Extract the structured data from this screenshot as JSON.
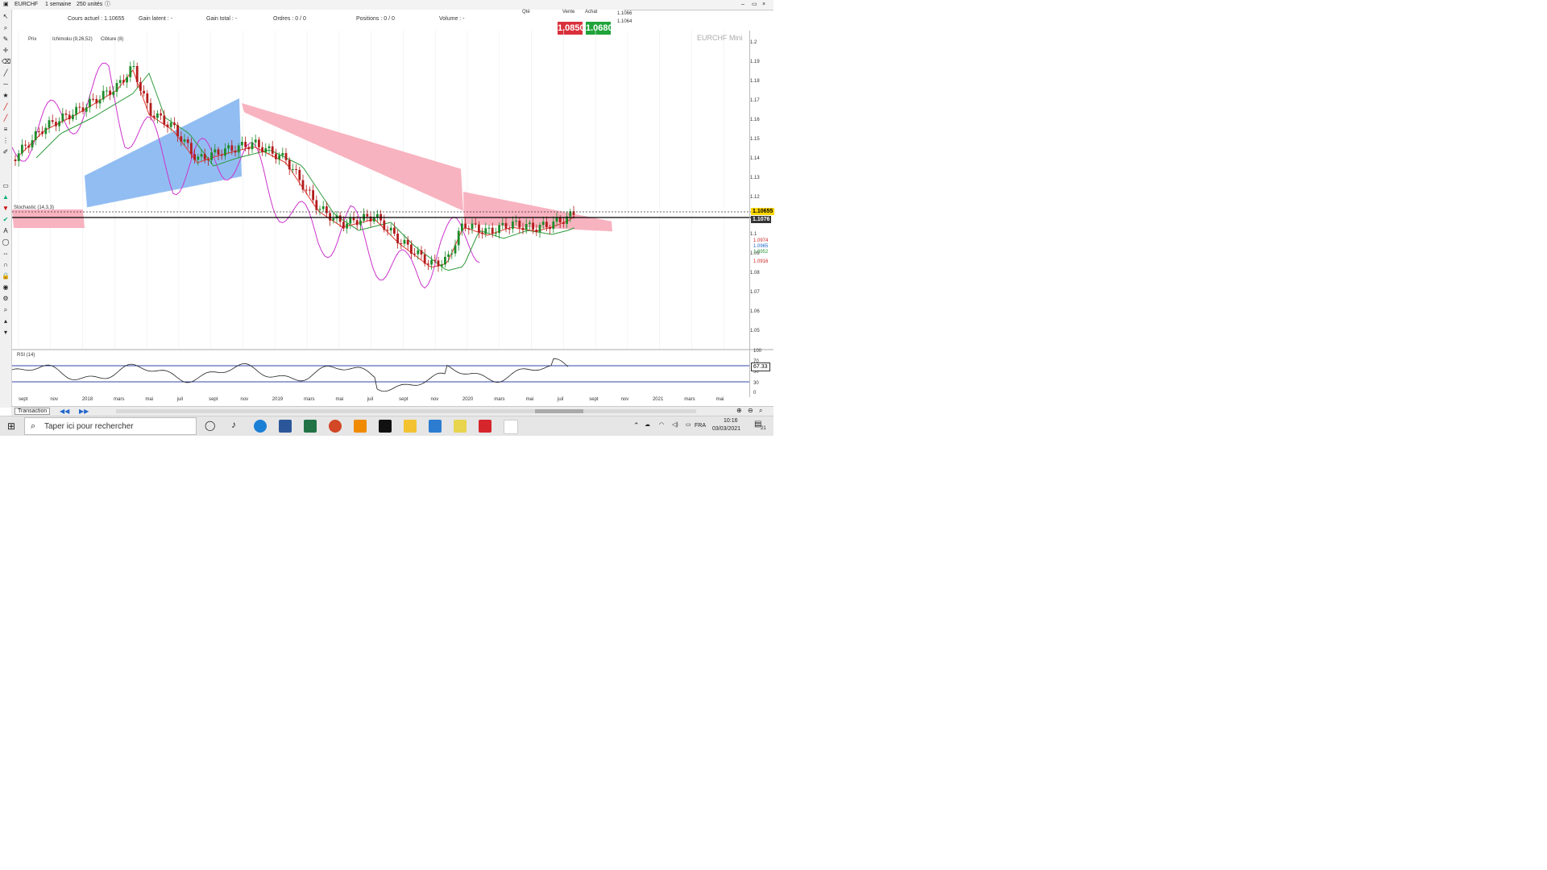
{
  "topbar": {
    "symbol": "EURCHF",
    "timeframe": "1 semaine",
    "period": "250 unités"
  },
  "info": {
    "items": [
      "Cours actuel : 1.10655",
      "Gain latent : -",
      "Gain total : -",
      "Ordres : 0 / 0",
      "Positions : 0 / 0",
      "Volume : -"
    ],
    "qty_label": "Qté",
    "sell_label": "Vente",
    "buy_label": "Achat",
    "sell_price": "1.0850",
    "buy_price": "1.0680",
    "side_values": [
      "1.1066",
      "1.1064"
    ]
  },
  "chart": {
    "watermark": "EURCHF Mini",
    "legend": [
      "Prix",
      "Ichimoku (9,26,52)",
      "Clôture (8)"
    ],
    "signal_label": "Stochastic (14,3,3)",
    "current_price": "1.10655",
    "second_price": "1.1076",
    "right_prices": [
      "1.2",
      "1.19",
      "1.18",
      "1.17",
      "1.16",
      "1.15",
      "1.14",
      "1.13",
      "1.12",
      "1.1",
      "1.09",
      "1.08",
      "1.07",
      "1.06",
      "1.05"
    ],
    "overlay_tags": [
      "1.0974",
      "1.0965",
      "1.0952",
      "1.0916"
    ]
  },
  "rsi": {
    "title": "RSI (14)",
    "levels": [
      "100",
      "70",
      "50",
      "30",
      "0"
    ],
    "value": "67.33"
  },
  "xaxis": [
    "sept",
    "nov",
    "2018",
    "mars",
    "mai",
    "juil",
    "sept",
    "nov",
    "2019",
    "mars",
    "mai",
    "juil",
    "sept",
    "nov",
    "2020",
    "mars",
    "mai",
    "juil",
    "sept",
    "nov",
    "2021",
    "mars",
    "mai"
  ],
  "bottom": {
    "tab_label": "Transaction"
  },
  "taskbar": {
    "search_placeholder": "Taper ici pour rechercher",
    "language": "FRA",
    "time": "10:16",
    "date": "03/03/2021",
    "notifications": "21"
  },
  "colors": {
    "bull": "#1e8c2a",
    "bear": "#b31d1d",
    "kumo_bull": "#7fb2f0",
    "kumo_bear": "#f7a6b5",
    "chikou": "#cc33cc",
    "kijun": "#2d9a3a",
    "tenkan": "#e0342c",
    "sell_box": "#d9303b",
    "buy_box": "#1fa33a"
  }
}
